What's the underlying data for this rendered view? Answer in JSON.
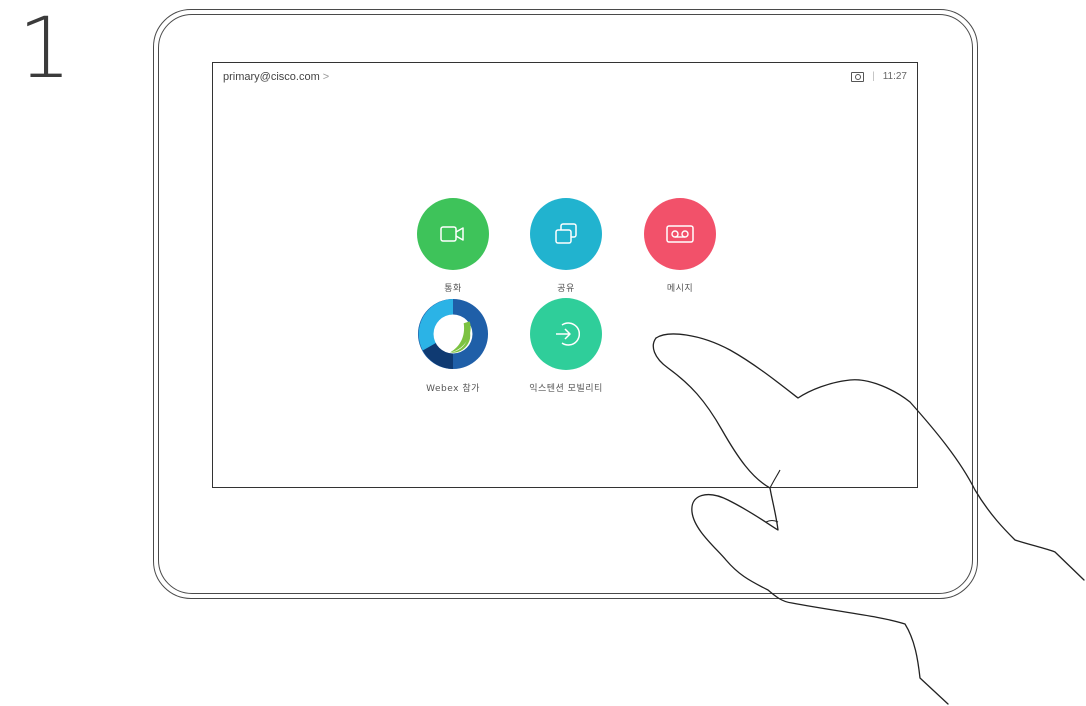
{
  "step": "1",
  "header": {
    "account": "primary@cisco.com",
    "chevron": ">",
    "selfview_icon": "selfview-icon",
    "time": "11:27"
  },
  "tiles": [
    {
      "label": "통화",
      "icon": "video-camera-icon",
      "color": "#3ec35a"
    },
    {
      "label": "공유",
      "icon": "share-screen-icon",
      "color": "#21b3cf"
    },
    {
      "label": "메시지",
      "icon": "voicemail-icon",
      "color": "#f2516a"
    },
    {
      "label": "Webex 참가",
      "icon": "webex-logo-icon",
      "color": "#1f5fa8"
    },
    {
      "label": "익스텐션 모빌리티",
      "icon": "sign-in-arrow-icon",
      "color": "#2fce9a"
    }
  ]
}
